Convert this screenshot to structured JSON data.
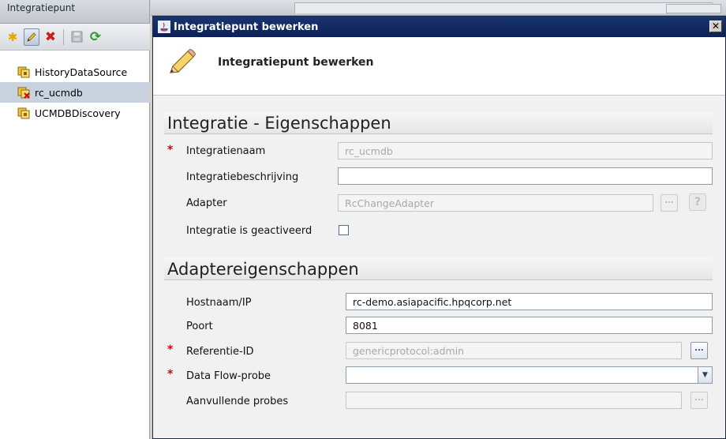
{
  "left_panel": {
    "title": "Integratiepunt",
    "toolbar": {
      "new_icon": "asterisk-new-icon",
      "edit_icon": "pencil-edit-icon",
      "delete_icon": "red-x-delete-icon",
      "save_icon": "disk-save-icon",
      "refresh_icon": "green-refresh-icon"
    },
    "tree_items": [
      {
        "label": "HistoryDataSource",
        "selected": false
      },
      {
        "label": "rc_ucmdb",
        "selected": true
      },
      {
        "label": "UCMDBDiscovery",
        "selected": false
      }
    ]
  },
  "dialog": {
    "title": "Integratiepunt bewerken",
    "close_glyph": "✕",
    "header_title": "Integratiepunt bewerken",
    "section1": {
      "title": "Integratie - Eigenschappen",
      "fields": {
        "name_label": "Integratienaam",
        "name_value": "rc_ucmdb",
        "description_label": "Integratiebeschrijving",
        "description_value": "",
        "adapter_label": "Adapter",
        "adapter_value": "RcChangeAdapter",
        "activated_label": "Integratie is geactiveerd",
        "activated_checked": false
      }
    },
    "section2": {
      "title": "Adaptereigenschappen",
      "fields": {
        "host_label": "Hostnaam/IP",
        "host_value": "rc-demo.asiapacific.hpqcorp.net",
        "port_label": "Poort",
        "port_value": "8081",
        "credential_label": "Referentie-ID",
        "credential_value": "genericprotocol:admin",
        "probe_label": "Data Flow-probe",
        "probe_value": "",
        "extra_probes_label": "Aanvullende probes",
        "extra_probes_value": ""
      }
    },
    "required_marker": "*",
    "ellipsis_label": "...",
    "help_label": "?"
  },
  "colors": {
    "titlebar": "#0b2058",
    "required": "#d0001a",
    "selected_row": "#c9d2df"
  }
}
